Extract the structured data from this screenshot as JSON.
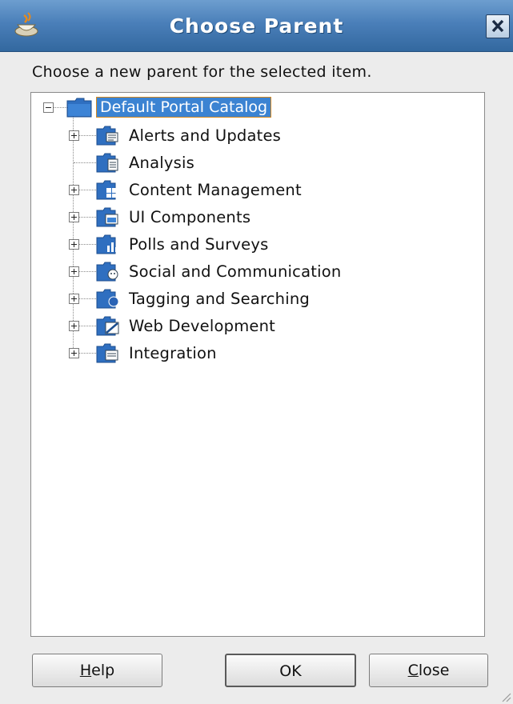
{
  "window": {
    "title": "Choose Parent",
    "instruction": "Choose a new parent for the selected item."
  },
  "tree": {
    "root": {
      "label": "Default Portal Catalog",
      "expanded": true,
      "selected": true
    },
    "children": [
      {
        "label": "Alerts and Updates",
        "expandable": true,
        "icon": "alerts-folder-icon"
      },
      {
        "label": "Analysis",
        "expandable": false,
        "icon": "analysis-folder-icon"
      },
      {
        "label": "Content Management",
        "expandable": true,
        "icon": "content-folder-icon"
      },
      {
        "label": "UI Components",
        "expandable": true,
        "icon": "ui-components-folder-icon"
      },
      {
        "label": "Polls and Surveys",
        "expandable": true,
        "icon": "polls-folder-icon"
      },
      {
        "label": "Social and Communication",
        "expandable": true,
        "icon": "social-folder-icon"
      },
      {
        "label": "Tagging and Searching",
        "expandable": true,
        "icon": "tagging-folder-icon"
      },
      {
        "label": "Web Development",
        "expandable": true,
        "icon": "webdev-folder-icon"
      },
      {
        "label": "Integration",
        "expandable": true,
        "icon": "integration-folder-icon"
      }
    ]
  },
  "buttons": {
    "help_mnemonic": "H",
    "help_rest": "elp",
    "ok": "OK",
    "close_mnemonic": "C",
    "close_rest": "lose"
  },
  "colors": {
    "titlebar": "#4a7fb9",
    "selection": "#3b83d2",
    "focus_border": "#d6891e",
    "folder_blue": "#2f6fc0"
  }
}
